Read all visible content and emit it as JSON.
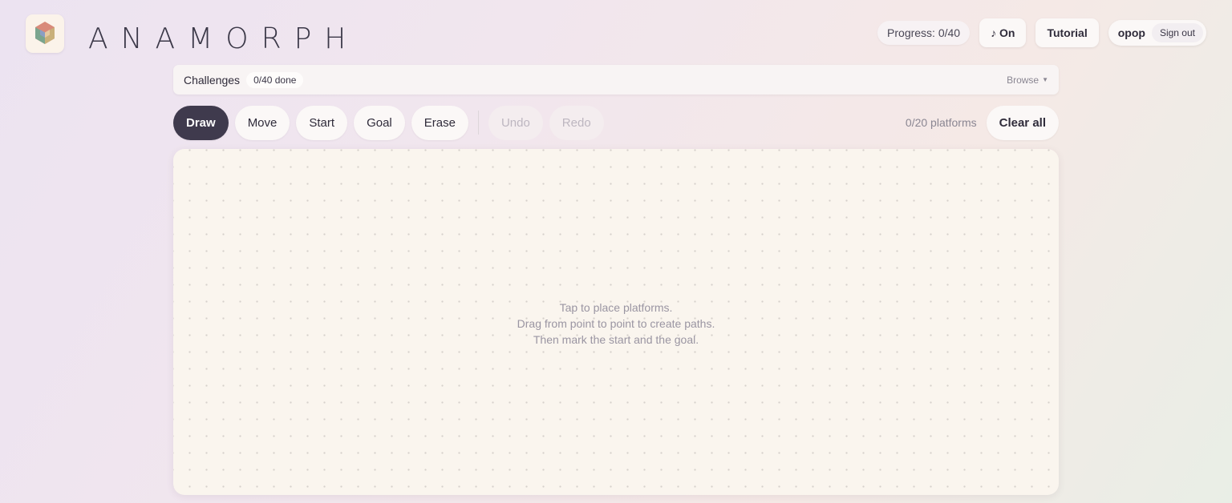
{
  "app": {
    "name": "ANAMORPH"
  },
  "header": {
    "progress": "Progress: 0/40",
    "music_label": "♪ On",
    "tutorial_label": "Tutorial",
    "user_name": "opop",
    "signout_label": "Sign out"
  },
  "challenges": {
    "label": "Challenges",
    "badge": "0/40 done",
    "browse_label": "Browse",
    "browse_icon": "chevron-down-icon"
  },
  "toolbar": {
    "tools": [
      {
        "label": "Draw",
        "state": "active"
      },
      {
        "label": "Move",
        "state": "normal"
      },
      {
        "label": "Start",
        "state": "normal"
      },
      {
        "label": "Goal",
        "state": "normal"
      },
      {
        "label": "Erase",
        "state": "normal"
      }
    ],
    "history": [
      {
        "label": "Undo",
        "state": "disabled"
      },
      {
        "label": "Redo",
        "state": "disabled"
      }
    ],
    "platform_count": "0/20 platforms",
    "clear_label": "Clear all"
  },
  "canvas": {
    "hint_lines": [
      "Tap to place platforms.",
      "Drag from point to point to create paths.",
      "Then mark the start and the goal."
    ]
  },
  "colors": {
    "accent_dark": "#3f3a4d",
    "canvas_bg": "#faf5ee"
  }
}
